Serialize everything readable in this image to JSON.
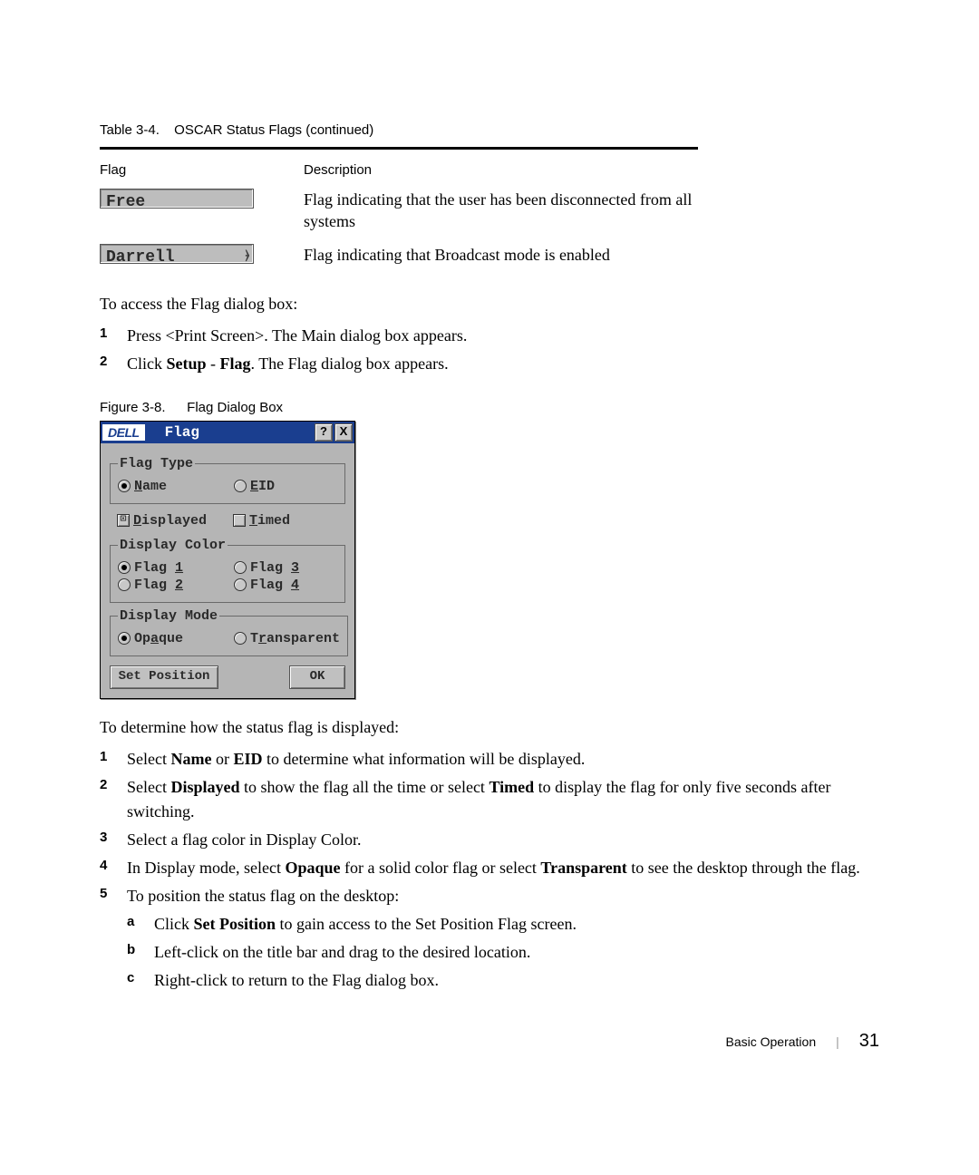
{
  "table": {
    "caption_num": "Table 3-4.",
    "caption_text": "OSCAR Status Flags (continued)",
    "headers": {
      "flag": "Flag",
      "desc": "Description"
    },
    "rows": [
      {
        "chip": "Free",
        "desc": "Flag indicating that the user has been disconnected from all systems"
      },
      {
        "chip": "Darrell",
        "desc": "Flag indicating that Broadcast mode is enabled"
      }
    ]
  },
  "access": {
    "lead": "To access the Flag dialog box:",
    "steps": [
      {
        "n": "1",
        "text_pre": "Press <Print Screen>. The Main dialog box appears."
      },
      {
        "n": "2",
        "text_pre": "Click ",
        "b1": "Setup",
        "mid": " - ",
        "b2": "Flag",
        "text_post": ". The Flag dialog box appears."
      }
    ]
  },
  "figure": {
    "caption_num": "Figure 3-8.",
    "caption_text": "Flag Dialog Box",
    "dialog": {
      "logo": "DELL",
      "title": "Flag",
      "help": "?",
      "close": "X",
      "groups": {
        "flag_type": {
          "legend": "Flag Type",
          "name": {
            "label_u": "N",
            "label_rest": "ame",
            "sel": true
          },
          "eid": {
            "label_u": "E",
            "label_rest": "ID",
            "sel": false
          }
        },
        "disp": {
          "displayed": {
            "label_u": "D",
            "label_rest": "isplayed",
            "checked": true,
            "glyph": "⊡"
          },
          "timed": {
            "label_u": "T",
            "label_rest": "imed",
            "checked": false
          }
        },
        "color": {
          "legend": "Display Color",
          "f1": {
            "label": "Flag ",
            "u": "1",
            "sel": true
          },
          "f2": {
            "label": "Flag ",
            "u": "2",
            "sel": false
          },
          "f3": {
            "label": "Flag ",
            "u": "3",
            "sel": false
          },
          "f4": {
            "label": "Flag ",
            "u": "4",
            "sel": false
          }
        },
        "mode": {
          "legend": "Display Mode",
          "opaque": {
            "label_pre": "Op",
            "u": "a",
            "label_post": "que",
            "sel": true
          },
          "transp": {
            "label_pre": "T",
            "u": "r",
            "label_post": "ansparent",
            "sel": false
          }
        }
      },
      "buttons": {
        "set_position": "Set Position",
        "ok": "OK"
      }
    }
  },
  "determine": {
    "lead": "To determine how the status flag is displayed:",
    "steps": [
      {
        "n": "1",
        "pre": "Select ",
        "b1": "Name",
        "mid": " or ",
        "b2": "EID",
        "post": " to determine what information will be displayed."
      },
      {
        "n": "2",
        "pre": "Select ",
        "b1": "Displayed",
        "mid": " to show the flag all the time or select ",
        "b2": "Timed",
        "post": " to display the flag for only five seconds after switching."
      },
      {
        "n": "3",
        "plain": "Select a flag color in Display Color."
      },
      {
        "n": "4",
        "pre": "In Display mode, select ",
        "b1": "Opaque",
        "mid": " for a solid color flag or select ",
        "b2": "Transparent",
        "post": " to see the desktop through the flag."
      },
      {
        "n": "5",
        "plain": "To position the status flag on the desktop:",
        "sub": [
          {
            "n": "a",
            "pre": "Click ",
            "b1": "Set Position",
            "post": " to gain access to the Set Position Flag screen."
          },
          {
            "n": "b",
            "plain": "Left-click on the title bar and drag to the desired location."
          },
          {
            "n": "c",
            "plain": "Right-click to return to the Flag dialog box."
          }
        ]
      }
    ]
  },
  "footer": {
    "section": "Basic Operation",
    "page": "31"
  }
}
